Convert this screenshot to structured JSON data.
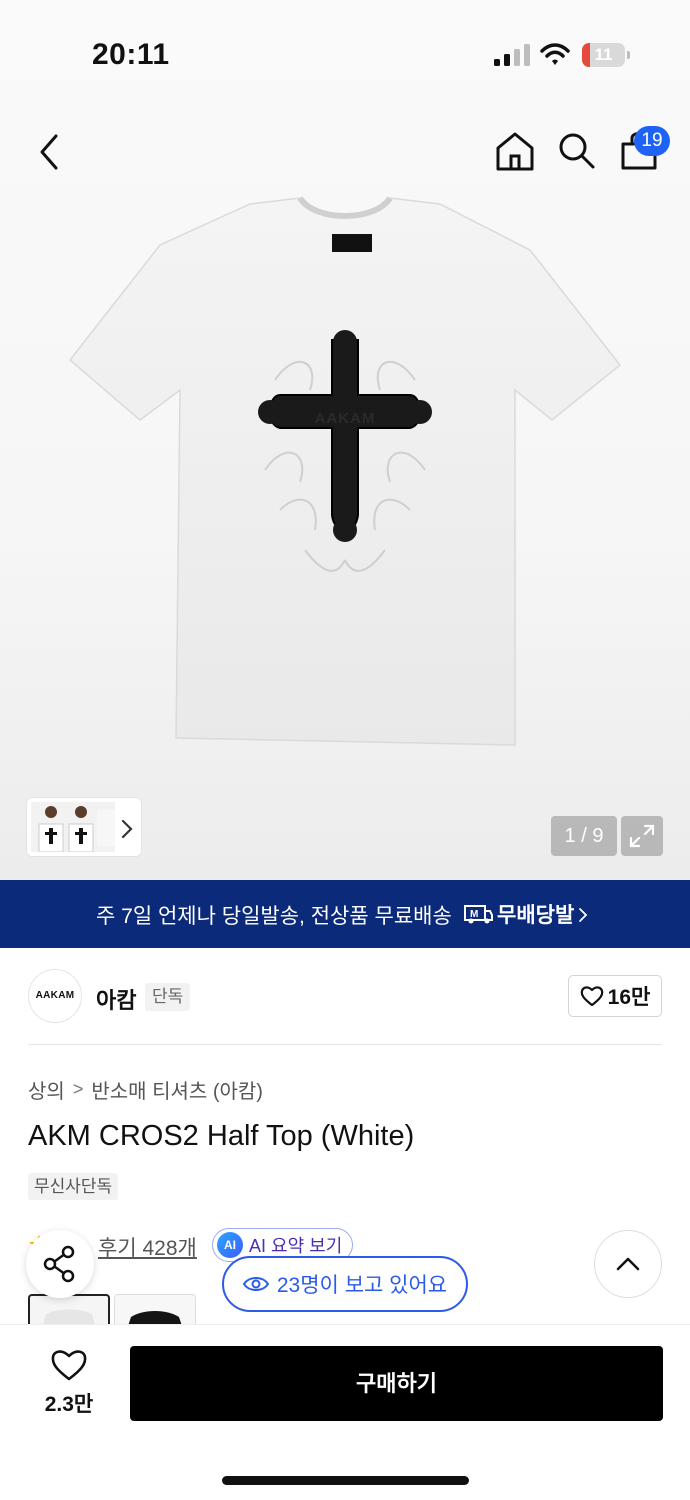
{
  "status_bar": {
    "time": "20:11",
    "battery_level": "11",
    "battery_fraction": 0.11,
    "battery_color": "#e5483c"
  },
  "header": {
    "icons": [
      "back-icon",
      "home-icon",
      "search-icon",
      "shopping-bag-icon"
    ],
    "cart_count": "19",
    "badge_color": "#1f63f5"
  },
  "gallery": {
    "product_logo_text": "AAKAM",
    "page_indicator": "1 / 9"
  },
  "delivery_banner": {
    "text": "주 7일 언제나 당일발송, 전상품 무료배송",
    "logo_mark": "M",
    "logo_text": "무배당발",
    "background": "#0c2a7a"
  },
  "brand": {
    "logo_text": "AAKAM",
    "name": "아캄",
    "tag": "단독",
    "likes": "16만"
  },
  "breadcrumb": {
    "items": [
      "상의",
      "반소매 티셔츠 (아캄)"
    ],
    "separator": ">"
  },
  "product": {
    "title": "AKM CROS2 Half Top (White)",
    "exclusive_tag": "무신사단독",
    "review_link": "후기 428개",
    "ai_badge": "AI",
    "ai_summary_label": "AI 요약 보기",
    "viewers_text": "23명이 보고 있어요",
    "swatches": [
      "white",
      "black"
    ]
  },
  "bottom_bar": {
    "wish_count": "2.3만",
    "buy_label": "구매하기"
  }
}
